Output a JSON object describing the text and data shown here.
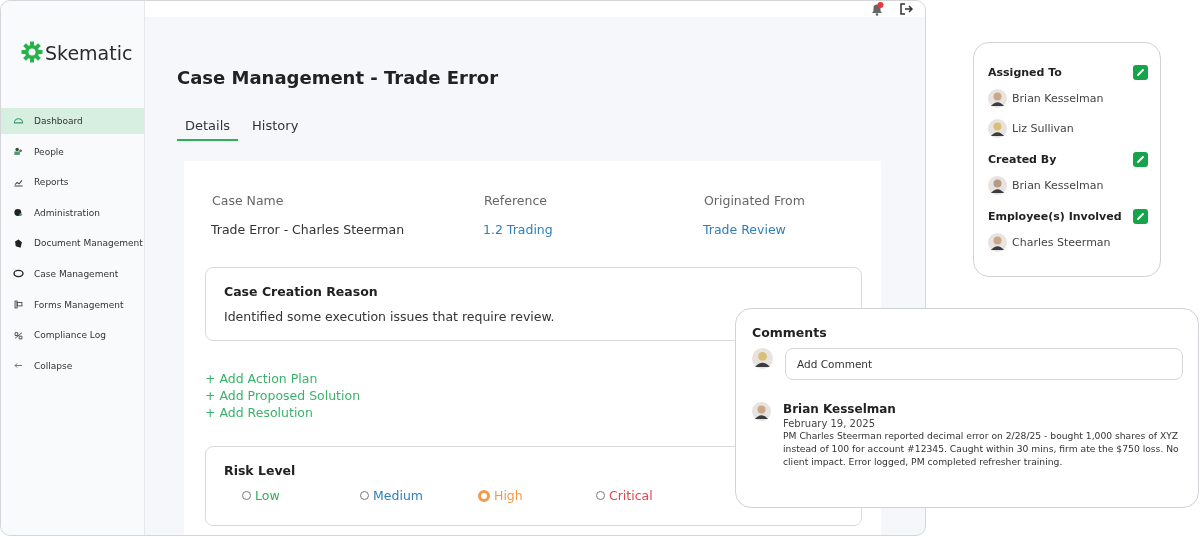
{
  "app": {
    "logo": "Skematic",
    "sidebar": {
      "items": [
        {
          "label": "Dashboard",
          "selected": true
        },
        {
          "label": "People",
          "selected": false
        },
        {
          "label": "Reports",
          "selected": false
        },
        {
          "label": "Administration",
          "selected": false
        },
        {
          "label": "Document Management",
          "selected": false
        },
        {
          "label": "Case Management",
          "selected": false
        },
        {
          "label": "Forms Management",
          "selected": false
        },
        {
          "label": "Compliance Log",
          "selected": false
        },
        {
          "label": "Collapse",
          "selected": false
        }
      ]
    },
    "page_title": "Case Management - Trade Error",
    "tabs": [
      {
        "label": "Details",
        "selected": true
      },
      {
        "label": "History",
        "selected": false
      }
    ],
    "fields": [
      {
        "label": "Case Name",
        "value": "Trade Error - Charles Steerman",
        "kind": "text"
      },
      {
        "label": "Reference",
        "value": "1.2 Trading",
        "kind": "link"
      },
      {
        "label": "Originated From",
        "value": "Trade Review",
        "kind": "link"
      }
    ],
    "reason": {
      "title": "Case Creation Reason",
      "text": "Identified some execution issues that require review."
    },
    "actions": [
      "+ Add Action Plan",
      "+ Add Proposed Solution",
      "+ Add Resolution"
    ],
    "risk": {
      "title": "Risk Level",
      "options": [
        {
          "label": "Low",
          "selected": false,
          "color": "#2fae5a"
        },
        {
          "label": "Medium",
          "selected": false,
          "color": "#2f7fb8"
        },
        {
          "label": "High",
          "selected": true,
          "color": "#f29a4a"
        },
        {
          "label": "Critical",
          "selected": false,
          "color": "#e0474c"
        }
      ]
    }
  },
  "people_card": {
    "groups": [
      {
        "title": "Assigned To",
        "people": [
          "Brian Kesselman",
          "Liz Sullivan"
        ]
      },
      {
        "title": "Created By",
        "people": [
          "Brian Kesselman"
        ]
      },
      {
        "title": "Employee(s) Involved",
        "people": [
          "Charles Steerman"
        ]
      }
    ]
  },
  "comments": {
    "title": "Comments",
    "placeholder": "Add Comment",
    "items": [
      {
        "author": "Brian Kesselman",
        "date": "February 19, 2025",
        "text": "PM Charles Steerman reported decimal error on 2/28/25 - bought 1,000 shares of XYZ instead of 100 for account #12345. Caught within 30 mins, firm ate the $750 loss. No client impact. Error logged, PM completed refresher training."
      }
    ]
  }
}
